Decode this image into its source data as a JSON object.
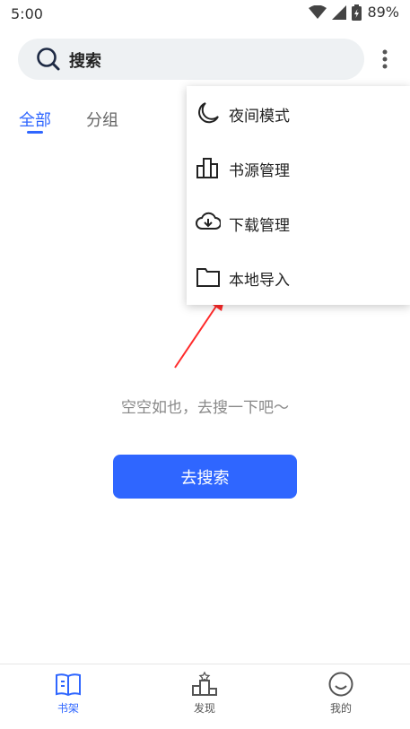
{
  "status_bar": {
    "time": "5:00",
    "battery": "89%"
  },
  "search": {
    "label": "搜索"
  },
  "tabs": {
    "all": "全部",
    "group": "分组"
  },
  "empty_state": {
    "text": "空空如也，去搜一下吧～",
    "button": "去搜索"
  },
  "menu": {
    "items": [
      {
        "label": "夜间模式",
        "icon": "moon-icon"
      },
      {
        "label": "书源管理",
        "icon": "bar-chart-icon"
      },
      {
        "label": "下载管理",
        "icon": "cloud-download-icon"
      },
      {
        "label": "本地导入",
        "icon": "folder-icon"
      }
    ]
  },
  "bottom_nav": {
    "items": [
      {
        "label": "书架",
        "icon": "book-icon"
      },
      {
        "label": "发现",
        "icon": "podium-icon"
      },
      {
        "label": "我的",
        "icon": "smile-icon"
      }
    ]
  },
  "colors": {
    "accent": "#2f66ff",
    "arrow": "#ff2a2a"
  }
}
